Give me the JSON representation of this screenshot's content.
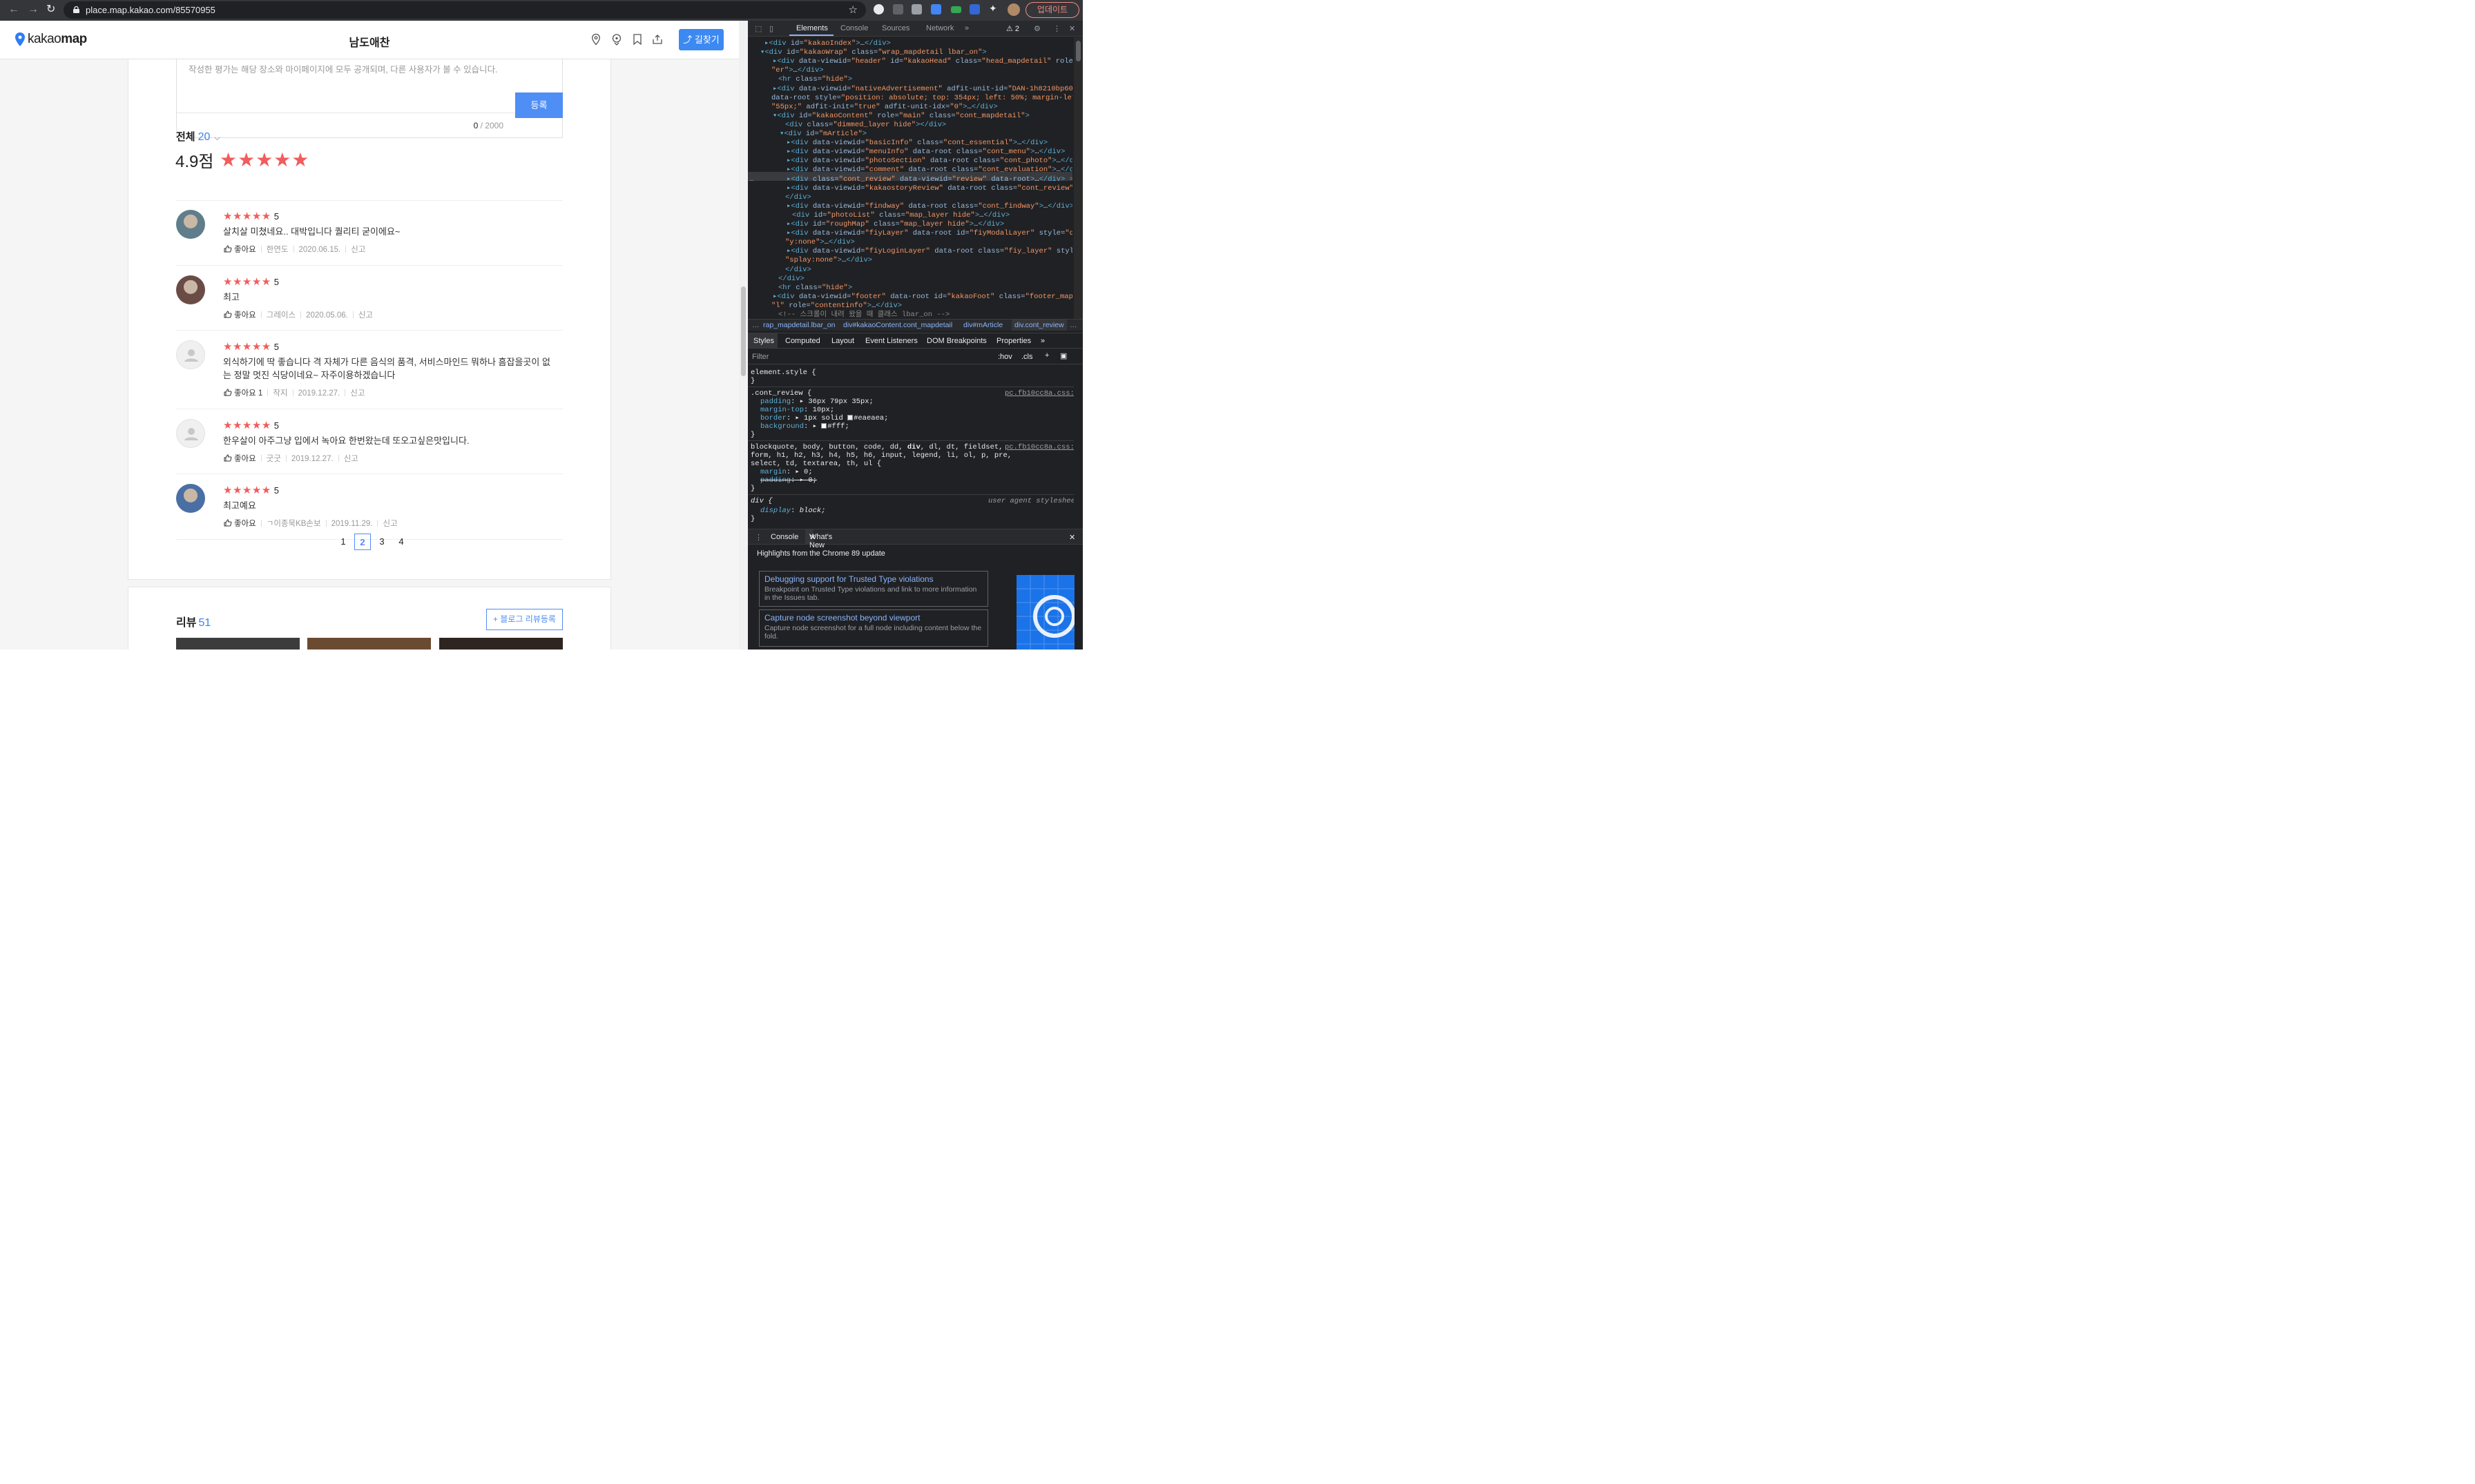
{
  "browser": {
    "url": "place.map.kakao.com/85570955",
    "update_label": "업데이트"
  },
  "header": {
    "logo_plain": "kakao",
    "logo_bold": "map",
    "title": "남도애찬",
    "route_button": "길찾기"
  },
  "write_box": {
    "placeholder": "작성한 평가는 해당 장소와 마이페이지에 모두 공개되며, 다른 사용자가 볼 수 있습니다.",
    "count": "0",
    "max": " / 2000",
    "submit": "등록"
  },
  "summary": {
    "label": "전체",
    "count": "20",
    "score": "4.9점",
    "stars": "★★★★★",
    "rating": 4.9
  },
  "reviews": [
    {
      "stars": "★★★★★",
      "score": "5",
      "text": "살치살 미쳤네요.. 대박입니다 퀄리티 굳이에요~",
      "like": "좋아요",
      "author": "한연도",
      "date": "2020.06.15.",
      "report": "신고",
      "avatar": "photo"
    },
    {
      "stars": "★★★★★",
      "score": "5",
      "text": "최고",
      "like": "좋아요",
      "author": "그레이스",
      "date": "2020.05.06.",
      "report": "신고",
      "avatar": "photo"
    },
    {
      "stars": "★★★★★",
      "score": "5",
      "text": "외식하기에 딱 좋습니다 격 자체가 다른 음식의 품격, 서비스마인드 뭐하나 흠잡을곳이 없는 정말 멋진 식당이네요~ 자주이용하겠습니다",
      "like": "좋아요 1",
      "author": "작지",
      "date": "2019.12.27.",
      "report": "신고",
      "avatar": "default"
    },
    {
      "stars": "★★★★★",
      "score": "5",
      "text": "한우살이 아주그냥 입에서 녹아요 한번왔는데 또오고싶은맛입니다.",
      "like": "좋아요",
      "author": "굿굿",
      "date": "2019.12.27.",
      "report": "신고",
      "avatar": "default"
    },
    {
      "stars": "★★★★★",
      "score": "5",
      "text": "최고예요",
      "like": "좋아요",
      "author": "ㄱ이종묵KB손보",
      "date": "2019.11.29.",
      "report": "신고",
      "avatar": "photo"
    }
  ],
  "pagination": {
    "pages": [
      "1",
      "2",
      "3",
      "4"
    ],
    "current": "2"
  },
  "blog_section": {
    "title": "리뷰",
    "count": "51",
    "button": "+ 블로그 리뷰등록"
  },
  "devtools": {
    "tabs": [
      "Elements",
      "Console",
      "Sources",
      "Network",
      "»"
    ],
    "active_tab": "Elements",
    "warnings": "⚠ 2",
    "dom_lines": [
      {
        "html": "<span class='tg'>▸&lt;div</span> <span class='at'>id=</span><span class='av'>\"kakaoIndex\"</span><span class='tg'>&gt;</span><span class='tx'>…</span><span class='tg'>&lt;/div&gt;</span>"
      },
      {
        "html": "<span class='tg'>▾&lt;div</span> <span class='at'>id=</span><span class='av'>\"kakaoWrap\"</span> <span class='at'>class=</span><span class='av'>\"wrap_mapdetail lbar_on\"</span><span class='tg'>&gt;</span>"
      }
    ],
    "crumbs": [
      "…",
      "rap_mapdetail.lbar_on",
      "div#kakaoContent.cont_mapdetail",
      "div#mArticle",
      "div.cont_review",
      "…"
    ],
    "style_tabs": [
      "Styles",
      "Computed",
      "Layout",
      "Event Listeners",
      "DOM Breakpoints",
      "Properties",
      "»"
    ],
    "filter_placeholder": "Filter",
    "hov": ":hov",
    "cls": ".cls",
    "drawer_tabs": [
      "Console",
      "What's New"
    ],
    "highlights": "Highlights from the Chrome 89 update",
    "news": [
      {
        "title": "Debugging support for Trusted Type violations",
        "desc": "Breakpoint on Trusted Type violations and link to more information in the Issues tab."
      },
      {
        "title": "Capture node screenshot beyond viewport",
        "desc": "Capture node screenshot for a full node including content below the fold."
      }
    ]
  }
}
